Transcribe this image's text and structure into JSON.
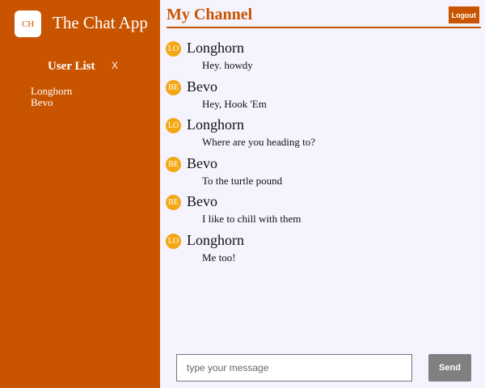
{
  "app": {
    "logo_text": "CH",
    "title": "The Chat App"
  },
  "sidebar": {
    "title": "User List",
    "close_label": "X",
    "users": [
      "Longhorn",
      "Bevo"
    ]
  },
  "channel": {
    "title": "My Channel",
    "logout_label": "Logout"
  },
  "messages": [
    {
      "avatar": "LO",
      "sender": "Longhorn",
      "text": "Hey. howdy"
    },
    {
      "avatar": "BE",
      "sender": "Bevo",
      "text": "Hey, Hook 'Em"
    },
    {
      "avatar": "LO",
      "sender": "Longhorn",
      "text": "Where are you heading to?"
    },
    {
      "avatar": "BE",
      "sender": "Bevo",
      "text": "To the turtle pound"
    },
    {
      "avatar": "BE",
      "sender": "Bevo",
      "text": "I like to chill with them"
    },
    {
      "avatar": "LO",
      "sender": "Longhorn",
      "text": "Me too!"
    }
  ],
  "composer": {
    "placeholder": "type your message",
    "value": "",
    "send_label": "Send"
  },
  "colors": {
    "brand": "#c95400",
    "avatar": "#f3a712",
    "background": "#f5f3fd",
    "send_button": "#808080"
  }
}
